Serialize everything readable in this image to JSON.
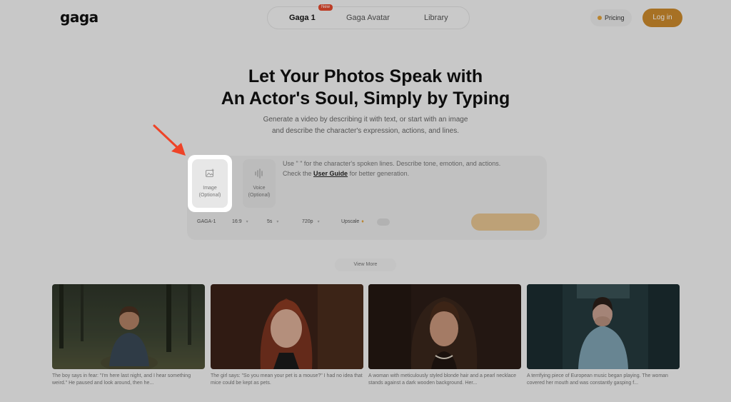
{
  "header": {
    "logo": "gaga",
    "nav": [
      {
        "label": "Gaga 1",
        "badge": "New",
        "active": true
      },
      {
        "label": "Gaga Avatar",
        "active": false
      },
      {
        "label": "Library",
        "active": false
      }
    ],
    "pricing_label": "Pricing",
    "login_label": "Log in"
  },
  "hero": {
    "title_line1": "Let Your Photos Speak with",
    "title_line2": "An Actor's Soul, Simply by Typing",
    "subtitle_line1": "Generate a video by describing it with text, or start with an image",
    "subtitle_line2": "and describe the character's expression, actions, and lines."
  },
  "composer": {
    "image_tile": {
      "label": "Image",
      "sublabel": "(Optional)",
      "icon": "image-add-icon"
    },
    "voice_tile": {
      "label": "Voice",
      "sublabel": "(Optional)",
      "icon": "audio-wave-icon"
    },
    "hint_line1": "Use \" \" for the character's spoken lines. Describe tone, emotion, and actions.",
    "hint_line2_prefix": "Check the",
    "hint_link": "User Guide",
    "hint_line2_suffix": "for better generation.",
    "options": {
      "model": "GAGA-1",
      "aspect": "16:9",
      "duration": "5s",
      "resolution": "720p",
      "upscale": "Upscale"
    },
    "upscale_enabled": false
  },
  "view_more_label": "View More",
  "gallery": [
    {
      "caption": "The boy says in fear: \"I'm here last night, and I hear something weird.\" He paused and look around, then he...",
      "scene": "forest-boy"
    },
    {
      "caption": "The girl says: \"So you mean your pet is a mouse?\" I had no idea that mice could be kept as pets.",
      "scene": "red-hair-girl"
    },
    {
      "caption": "A woman with meticulously styled blonde hair and a pearl necklace stands against a dark wooden background. Her...",
      "scene": "pearl-woman"
    },
    {
      "caption": "A terrifying piece of European music began playing. The woman covered her mouth and was constantly gasping f...",
      "scene": "hospital-woman"
    }
  ],
  "colors": {
    "accent": "#cc8a2c",
    "badge": "#e64a2e",
    "highlight_arrow": "#ee4428"
  }
}
